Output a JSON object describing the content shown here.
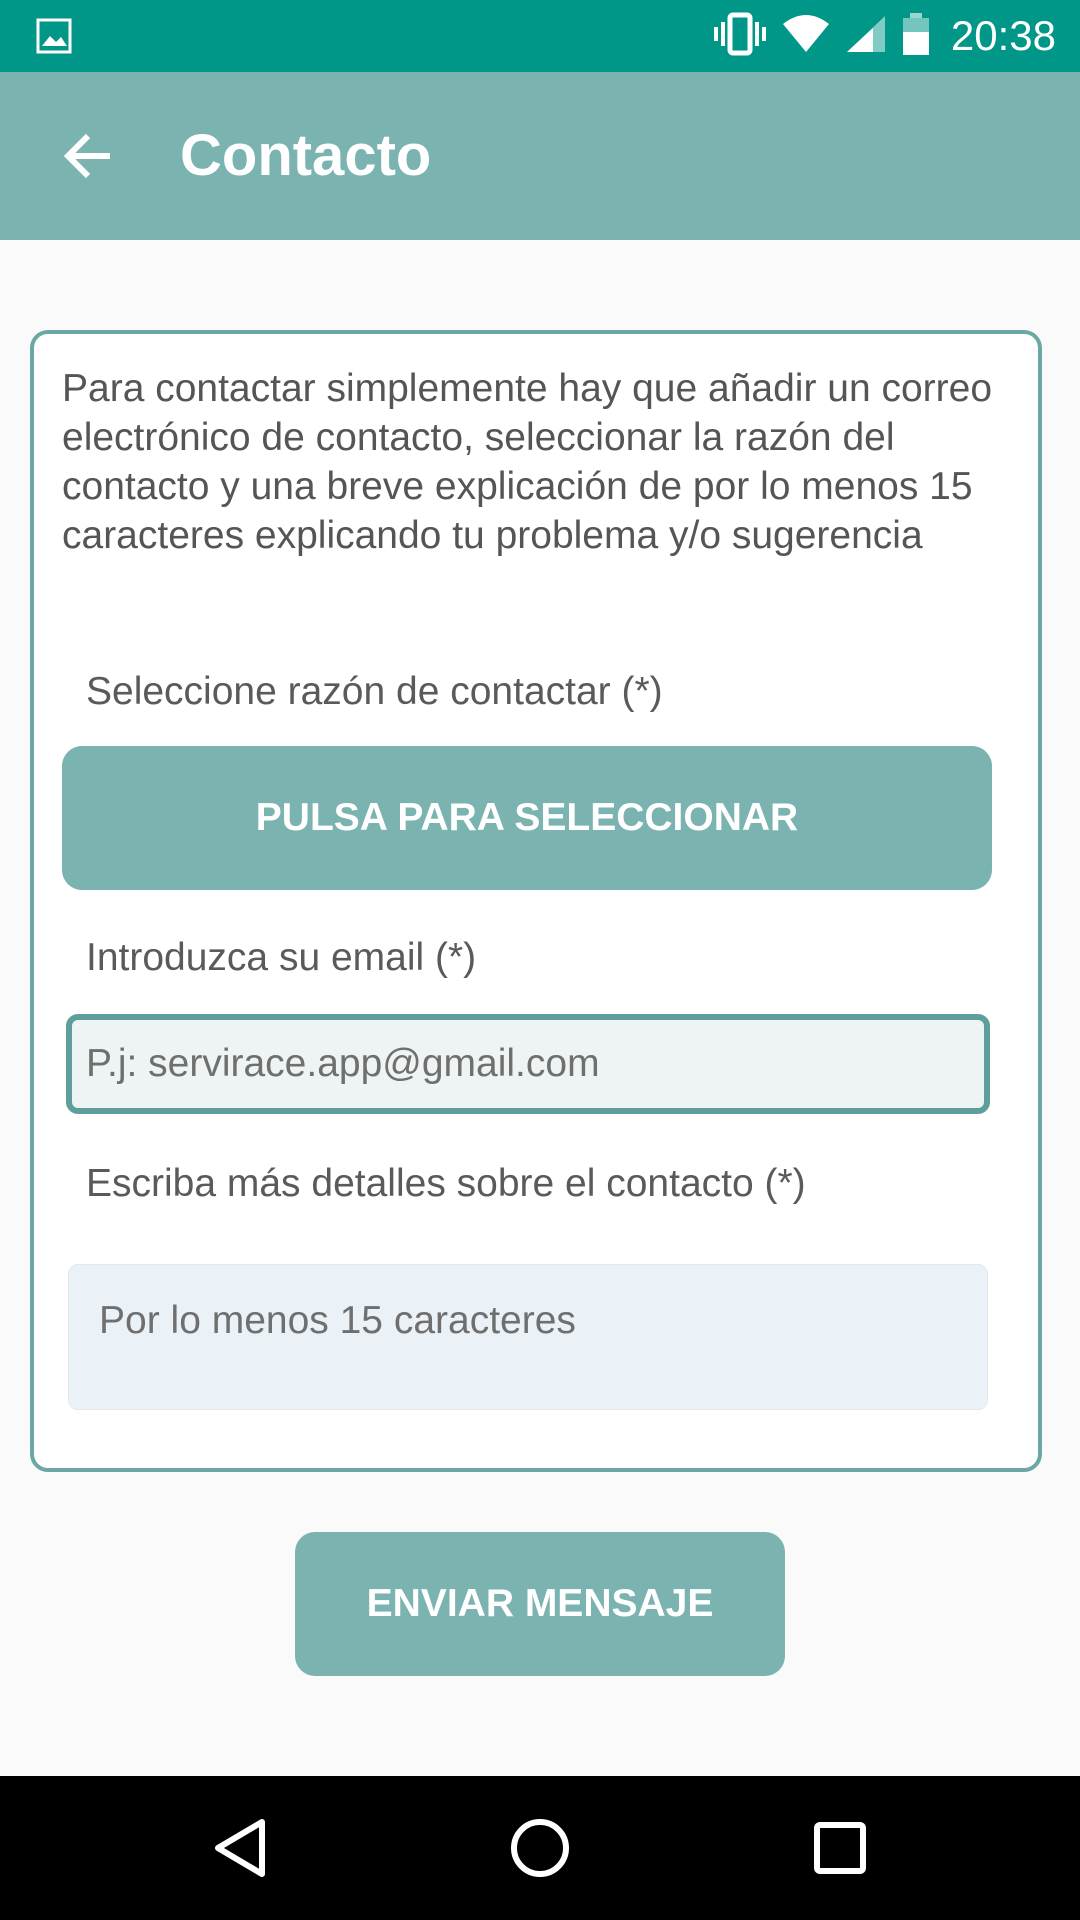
{
  "status_bar": {
    "time": "20:38",
    "icons": [
      "image-notification-icon",
      "vibrate-icon",
      "wifi-icon",
      "signal-icon",
      "battery-icon"
    ]
  },
  "app_bar": {
    "title": "Contacto",
    "back_icon": "arrow-left-icon"
  },
  "form": {
    "intro": "Para contactar simplemente hay que añadir un correo electrónico de contacto, seleccionar la razón del contacto y una breve explicación de por lo menos 15 caracteres explicando tu problema y/o sugerencia",
    "reason_label": "Seleccione razón de contactar (*)",
    "reason_button": "PULSA PARA SELECCIONAR",
    "email_label": "Introduzca su email (*)",
    "email_placeholder": "P.j: servirace.app@gmail.com",
    "details_label": "Escriba más detalles sobre el contacto (*)",
    "details_placeholder": "Por lo menos 15 caracteres"
  },
  "actions": {
    "send_button": "ENVIAR MENSAJE"
  },
  "nav_bar": {
    "icons": [
      "nav-back-icon",
      "nav-home-icon",
      "nav-recents-icon"
    ]
  },
  "colors": {
    "status_bar": "#009688",
    "app_bar": "#7ab3b0",
    "accent": "#6ba8a5",
    "background": "#fafafa"
  }
}
